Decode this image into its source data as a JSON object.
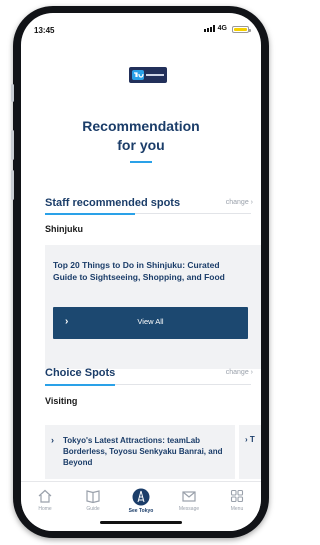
{
  "status": {
    "time": "13:45",
    "network": "4G"
  },
  "colors": {
    "navy": "#1b3d69",
    "accent": "#2aa1e8",
    "button": "#1c4870",
    "battery": "#f5d000"
  },
  "hero": {
    "title_line1": "Recommendation",
    "title_line2": "for you"
  },
  "staff_section": {
    "title": "Staff recommended spots",
    "change": "change ›",
    "area": "Shinjuku",
    "card_text": "Top 20 Things to Do in Shinjuku: Curated Guide to Sightseeing, Shopping, and Food",
    "view_all": "View All",
    "view_all_chevron": "›"
  },
  "choice_section": {
    "title": "Choice Spots",
    "change": "change ›",
    "area": "Visiting",
    "card_chevron": "›",
    "card_text": "Tokyo's Latest Attractions: teamLab Borderless, Toyosu Senkyaku Banrai, and Beyond",
    "next_card_text": "› T"
  },
  "tabs": [
    {
      "label": "Home",
      "icon": "home-icon"
    },
    {
      "label": "Guide",
      "icon": "book-icon"
    },
    {
      "label": "See Tokyo",
      "icon": "tokyo-tower-icon"
    },
    {
      "label": "Message",
      "icon": "envelope-icon"
    },
    {
      "label": "Menu",
      "icon": "grid-menu-icon"
    }
  ]
}
